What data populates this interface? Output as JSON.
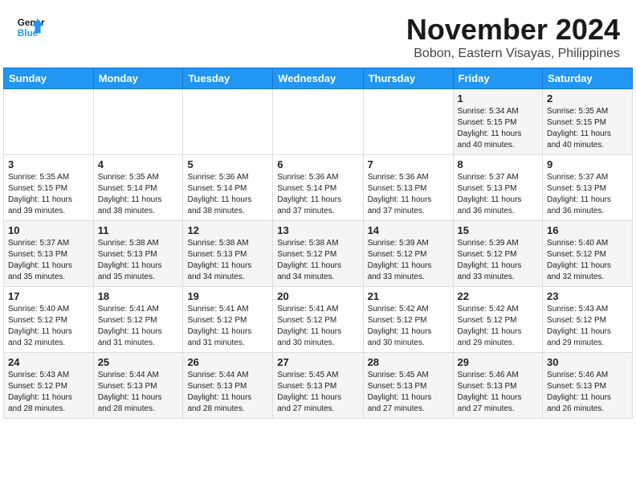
{
  "header": {
    "logo_line1": "General",
    "logo_line2": "Blue",
    "month": "November 2024",
    "location": "Bobon, Eastern Visayas, Philippines"
  },
  "weekdays": [
    "Sunday",
    "Monday",
    "Tuesday",
    "Wednesday",
    "Thursday",
    "Friday",
    "Saturday"
  ],
  "weeks": [
    [
      {
        "day": "",
        "content": ""
      },
      {
        "day": "",
        "content": ""
      },
      {
        "day": "",
        "content": ""
      },
      {
        "day": "",
        "content": ""
      },
      {
        "day": "",
        "content": ""
      },
      {
        "day": "1",
        "content": "Sunrise: 5:34 AM\nSunset: 5:15 PM\nDaylight: 11 hours\nand 40 minutes."
      },
      {
        "day": "2",
        "content": "Sunrise: 5:35 AM\nSunset: 5:15 PM\nDaylight: 11 hours\nand 40 minutes."
      }
    ],
    [
      {
        "day": "3",
        "content": "Sunrise: 5:35 AM\nSunset: 5:15 PM\nDaylight: 11 hours\nand 39 minutes."
      },
      {
        "day": "4",
        "content": "Sunrise: 5:35 AM\nSunset: 5:14 PM\nDaylight: 11 hours\nand 38 minutes."
      },
      {
        "day": "5",
        "content": "Sunrise: 5:36 AM\nSunset: 5:14 PM\nDaylight: 11 hours\nand 38 minutes."
      },
      {
        "day": "6",
        "content": "Sunrise: 5:36 AM\nSunset: 5:14 PM\nDaylight: 11 hours\nand 37 minutes."
      },
      {
        "day": "7",
        "content": "Sunrise: 5:36 AM\nSunset: 5:13 PM\nDaylight: 11 hours\nand 37 minutes."
      },
      {
        "day": "8",
        "content": "Sunrise: 5:37 AM\nSunset: 5:13 PM\nDaylight: 11 hours\nand 36 minutes."
      },
      {
        "day": "9",
        "content": "Sunrise: 5:37 AM\nSunset: 5:13 PM\nDaylight: 11 hours\nand 36 minutes."
      }
    ],
    [
      {
        "day": "10",
        "content": "Sunrise: 5:37 AM\nSunset: 5:13 PM\nDaylight: 11 hours\nand 35 minutes."
      },
      {
        "day": "11",
        "content": "Sunrise: 5:38 AM\nSunset: 5:13 PM\nDaylight: 11 hours\nand 35 minutes."
      },
      {
        "day": "12",
        "content": "Sunrise: 5:38 AM\nSunset: 5:13 PM\nDaylight: 11 hours\nand 34 minutes."
      },
      {
        "day": "13",
        "content": "Sunrise: 5:38 AM\nSunset: 5:12 PM\nDaylight: 11 hours\nand 34 minutes."
      },
      {
        "day": "14",
        "content": "Sunrise: 5:39 AM\nSunset: 5:12 PM\nDaylight: 11 hours\nand 33 minutes."
      },
      {
        "day": "15",
        "content": "Sunrise: 5:39 AM\nSunset: 5:12 PM\nDaylight: 11 hours\nand 33 minutes."
      },
      {
        "day": "16",
        "content": "Sunrise: 5:40 AM\nSunset: 5:12 PM\nDaylight: 11 hours\nand 32 minutes."
      }
    ],
    [
      {
        "day": "17",
        "content": "Sunrise: 5:40 AM\nSunset: 5:12 PM\nDaylight: 11 hours\nand 32 minutes."
      },
      {
        "day": "18",
        "content": "Sunrise: 5:41 AM\nSunset: 5:12 PM\nDaylight: 11 hours\nand 31 minutes."
      },
      {
        "day": "19",
        "content": "Sunrise: 5:41 AM\nSunset: 5:12 PM\nDaylight: 11 hours\nand 31 minutes."
      },
      {
        "day": "20",
        "content": "Sunrise: 5:41 AM\nSunset: 5:12 PM\nDaylight: 11 hours\nand 30 minutes."
      },
      {
        "day": "21",
        "content": "Sunrise: 5:42 AM\nSunset: 5:12 PM\nDaylight: 11 hours\nand 30 minutes."
      },
      {
        "day": "22",
        "content": "Sunrise: 5:42 AM\nSunset: 5:12 PM\nDaylight: 11 hours\nand 29 minutes."
      },
      {
        "day": "23",
        "content": "Sunrise: 5:43 AM\nSunset: 5:12 PM\nDaylight: 11 hours\nand 29 minutes."
      }
    ],
    [
      {
        "day": "24",
        "content": "Sunrise: 5:43 AM\nSunset: 5:12 PM\nDaylight: 11 hours\nand 28 minutes."
      },
      {
        "day": "25",
        "content": "Sunrise: 5:44 AM\nSunset: 5:13 PM\nDaylight: 11 hours\nand 28 minutes."
      },
      {
        "day": "26",
        "content": "Sunrise: 5:44 AM\nSunset: 5:13 PM\nDaylight: 11 hours\nand 28 minutes."
      },
      {
        "day": "27",
        "content": "Sunrise: 5:45 AM\nSunset: 5:13 PM\nDaylight: 11 hours\nand 27 minutes."
      },
      {
        "day": "28",
        "content": "Sunrise: 5:45 AM\nSunset: 5:13 PM\nDaylight: 11 hours\nand 27 minutes."
      },
      {
        "day": "29",
        "content": "Sunrise: 5:46 AM\nSunset: 5:13 PM\nDaylight: 11 hours\nand 27 minutes."
      },
      {
        "day": "30",
        "content": "Sunrise: 5:46 AM\nSunset: 5:13 PM\nDaylight: 11 hours\nand 26 minutes."
      }
    ]
  ]
}
